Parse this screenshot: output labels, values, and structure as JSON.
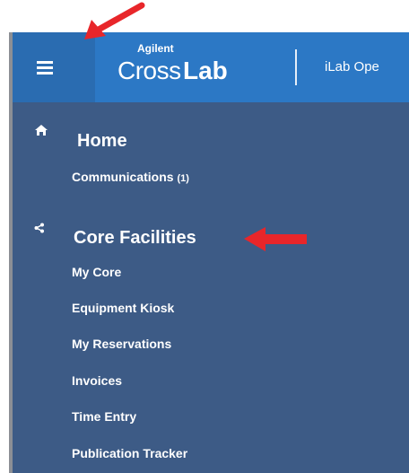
{
  "header": {
    "brand_small": "Agilent",
    "brand_cross": "Cross",
    "brand_lab": "Lab",
    "title": "iLab Ope"
  },
  "sidebar": {
    "sections": [
      {
        "title": "Home",
        "icon": "home-icon",
        "items": [
          {
            "label": "Communications",
            "badge": "(1)"
          }
        ]
      },
      {
        "title": "Core Facilities",
        "icon": "share-icon",
        "items": [
          {
            "label": "My Core"
          },
          {
            "label": "Equipment Kiosk"
          },
          {
            "label": "My Reservations"
          },
          {
            "label": "Invoices"
          },
          {
            "label": "Time Entry"
          },
          {
            "label": "Publication Tracker"
          }
        ]
      }
    ]
  },
  "annotations": {
    "arrow_color": "#e8262a"
  },
  "colors": {
    "header": "#2c78c5",
    "menu_button": "#2a6cb1",
    "sidebar": "#3d5b86"
  }
}
